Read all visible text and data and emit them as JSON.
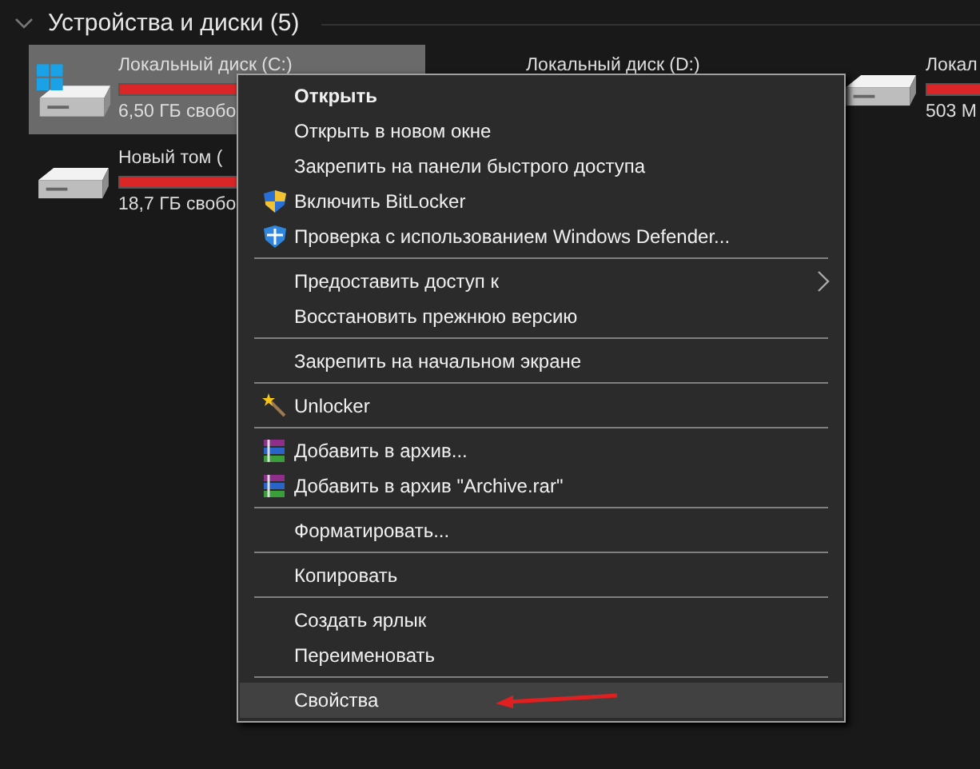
{
  "section": {
    "title": "Устройства и диски (5)",
    "expanded": true
  },
  "drives": [
    {
      "name": "Локальный диск (C:)",
      "free": "6,50 ГБ свобо",
      "level": 0.92,
      "selected": true,
      "system": true
    },
    {
      "name": "Локальный диск (D:)",
      "selected": false
    },
    {
      "name": "Локал",
      "free": "503 М",
      "level": 0.9,
      "selected": false,
      "system": false
    },
    {
      "name": "Новый том (",
      "free": "18,7 ГБ свобо",
      "level": 0.9,
      "selected": false,
      "system": false
    }
  ],
  "context_menu": {
    "items": [
      {
        "kind": "plain",
        "label": "Открыть",
        "bold": true,
        "selected": false
      },
      {
        "kind": "plain",
        "label": "Открыть в новом окне",
        "bold": false,
        "selected": false
      },
      {
        "kind": "plain",
        "label": "Закрепить на панели быстрого доступа",
        "bold": false,
        "selected": false
      },
      {
        "kind": "shield",
        "label": "Включить BitLocker",
        "bold": false,
        "selected": false
      },
      {
        "kind": "defender",
        "label": "Проверка с использованием Windows Defender...",
        "bold": false,
        "selected": false
      },
      {
        "kind": "separator"
      },
      {
        "kind": "submenu",
        "label": "Предоставить доступ к",
        "bold": false,
        "selected": false
      },
      {
        "kind": "plain",
        "label": "Восстановить прежнюю версию",
        "bold": false,
        "selected": false
      },
      {
        "kind": "separator"
      },
      {
        "kind": "plain",
        "label": "Закрепить на начальном экране",
        "bold": false,
        "selected": false
      },
      {
        "kind": "separator"
      },
      {
        "kind": "wand",
        "label": "Unlocker",
        "bold": false,
        "selected": false
      },
      {
        "kind": "separator"
      },
      {
        "kind": "archive",
        "label": "Добавить в архив...",
        "bold": false,
        "selected": false
      },
      {
        "kind": "archive",
        "label": "Добавить в архив \"Archive.rar\"",
        "bold": false,
        "selected": false
      },
      {
        "kind": "separator"
      },
      {
        "kind": "plain",
        "label": "Форматировать...",
        "bold": false,
        "selected": false
      },
      {
        "kind": "separator"
      },
      {
        "kind": "plain",
        "label": "Копировать",
        "bold": false,
        "selected": false
      },
      {
        "kind": "separator"
      },
      {
        "kind": "plain",
        "label": "Создать ярлык",
        "bold": false,
        "selected": false
      },
      {
        "kind": "plain",
        "label": "Переименовать",
        "bold": false,
        "selected": false
      },
      {
        "kind": "separator"
      },
      {
        "kind": "plain",
        "label": "Свойства",
        "bold": false,
        "selected": true
      }
    ]
  }
}
